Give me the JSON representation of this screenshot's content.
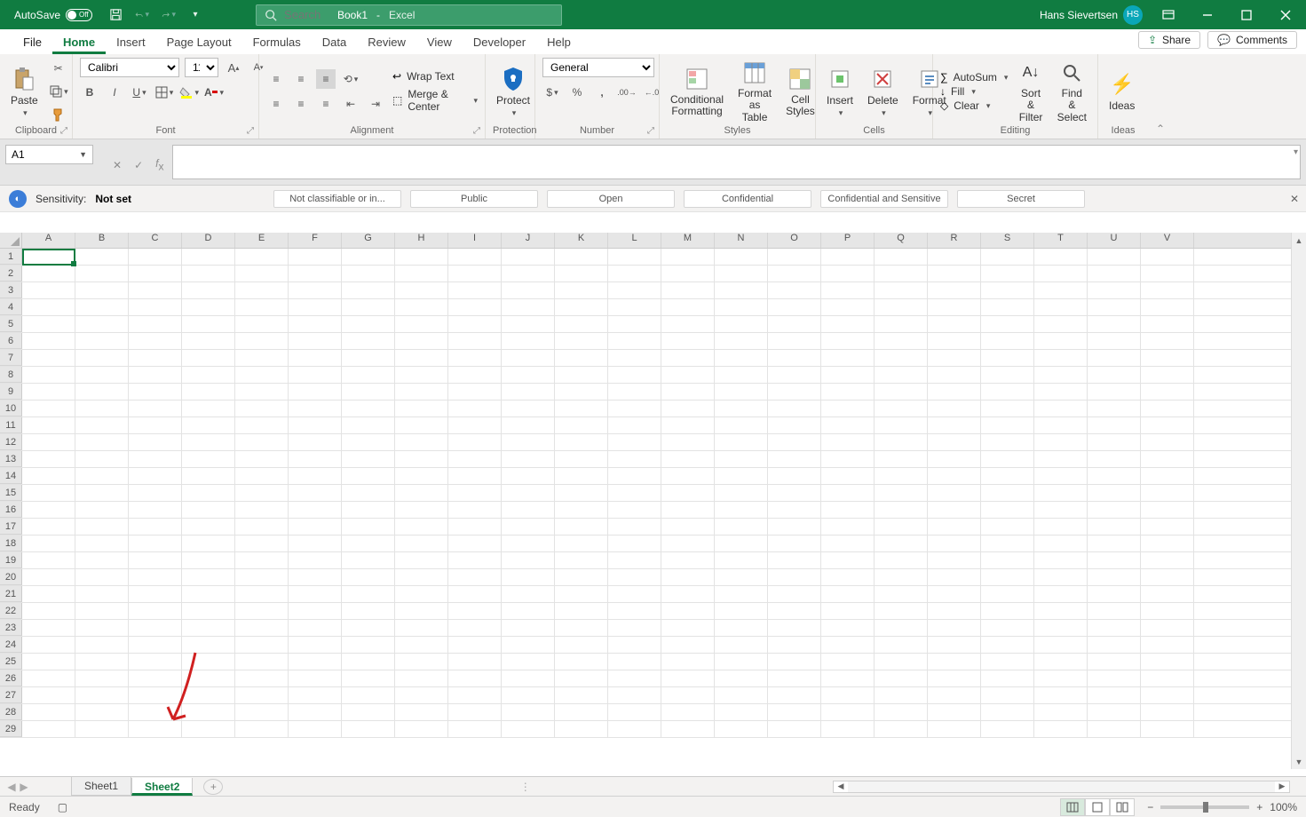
{
  "titlebar": {
    "autosave_label": "AutoSave",
    "autosave_state": "Off",
    "doc_title": "Book1",
    "app_name": "Excel",
    "search_placeholder": "Search",
    "user_name": "Hans Sievertsen",
    "user_initials": "HS"
  },
  "tabs": {
    "file": "File",
    "items": [
      "Home",
      "Insert",
      "Page Layout",
      "Formulas",
      "Data",
      "Review",
      "View",
      "Developer",
      "Help"
    ],
    "active": "Home",
    "share": "Share",
    "comments": "Comments"
  },
  "ribbon": {
    "clipboard": {
      "label": "Clipboard",
      "paste": "Paste"
    },
    "font": {
      "label": "Font",
      "name": "Calibri",
      "size": "11"
    },
    "alignment": {
      "label": "Alignment",
      "wrap": "Wrap Text",
      "merge": "Merge & Center"
    },
    "protection": {
      "label": "Protection",
      "protect": "Protect"
    },
    "number": {
      "label": "Number",
      "format": "General"
    },
    "styles": {
      "label": "Styles",
      "cond": "Conditional Formatting",
      "table": "Format as Table",
      "cell": "Cell Styles"
    },
    "cells": {
      "label": "Cells",
      "insert": "Insert",
      "delete": "Delete",
      "format": "Format"
    },
    "editing": {
      "label": "Editing",
      "autosum": "AutoSum",
      "fill": "Fill",
      "clear": "Clear",
      "sort": "Sort & Filter",
      "find": "Find & Select"
    },
    "ideas": {
      "label": "Ideas",
      "ideas": "Ideas"
    }
  },
  "namebox": "A1",
  "sensitivity": {
    "label": "Sensitivity:",
    "value": "Not set",
    "options": [
      "Not classifiable or in...",
      "Public",
      "Open",
      "Confidential",
      "Confidential and Sensitive",
      "Secret"
    ]
  },
  "columns": [
    "A",
    "B",
    "C",
    "D",
    "E",
    "F",
    "G",
    "H",
    "I",
    "J",
    "K",
    "L",
    "M",
    "N",
    "O",
    "P",
    "Q",
    "R",
    "S",
    "T",
    "U",
    "V"
  ],
  "rows": 29,
  "sheets": {
    "items": [
      "Sheet1",
      "Sheet2"
    ],
    "active": "Sheet2"
  },
  "status": {
    "ready": "Ready",
    "zoom": "100%"
  }
}
